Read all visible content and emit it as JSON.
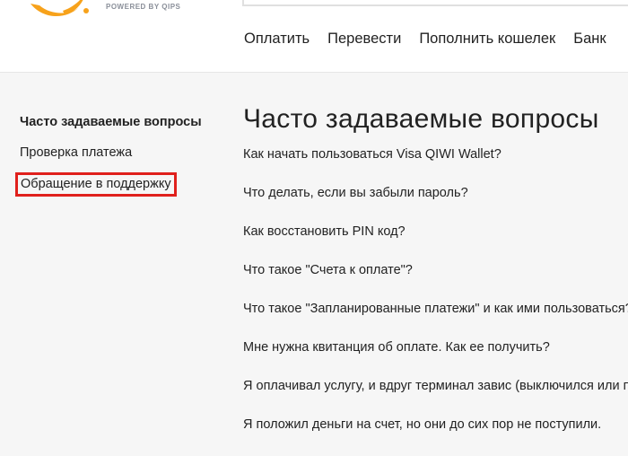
{
  "header": {
    "powered_by": "POWERED BY QIPS",
    "nav": [
      "Оплатить",
      "Перевести",
      "Пополнить кошелек",
      "Банк"
    ]
  },
  "sidebar": {
    "items": [
      {
        "label": "Часто задаваемые вопросы",
        "state": "active"
      },
      {
        "label": "Проверка платежа",
        "state": "normal"
      },
      {
        "label": "Обращение в поддержку",
        "state": "highlighted"
      }
    ],
    "highlight_color": "#e0201c"
  },
  "main": {
    "title": "Часто задаваемые вопросы",
    "faq": [
      "Как начать пользоваться Visa QIWI Wallet?",
      "Что делать, если вы забыли пароль?",
      "Как восстановить PIN код?",
      "Что такое \"Счета к оплате\"?",
      "Что такое \"Запланированные платежи\" и как ими пользоваться?",
      "Мне нужна квитанция об оплате. Как ее получить?",
      "Я оплачивал услугу, и вдруг терминал завис (выключился или перезагрузился)",
      "Я положил деньги на счет, но они до сих пор не поступили."
    ]
  },
  "colors": {
    "logo_orange": "#f7a21b",
    "text": "#222222",
    "muted": "#8a8f99",
    "background": "#f6f6f6"
  }
}
